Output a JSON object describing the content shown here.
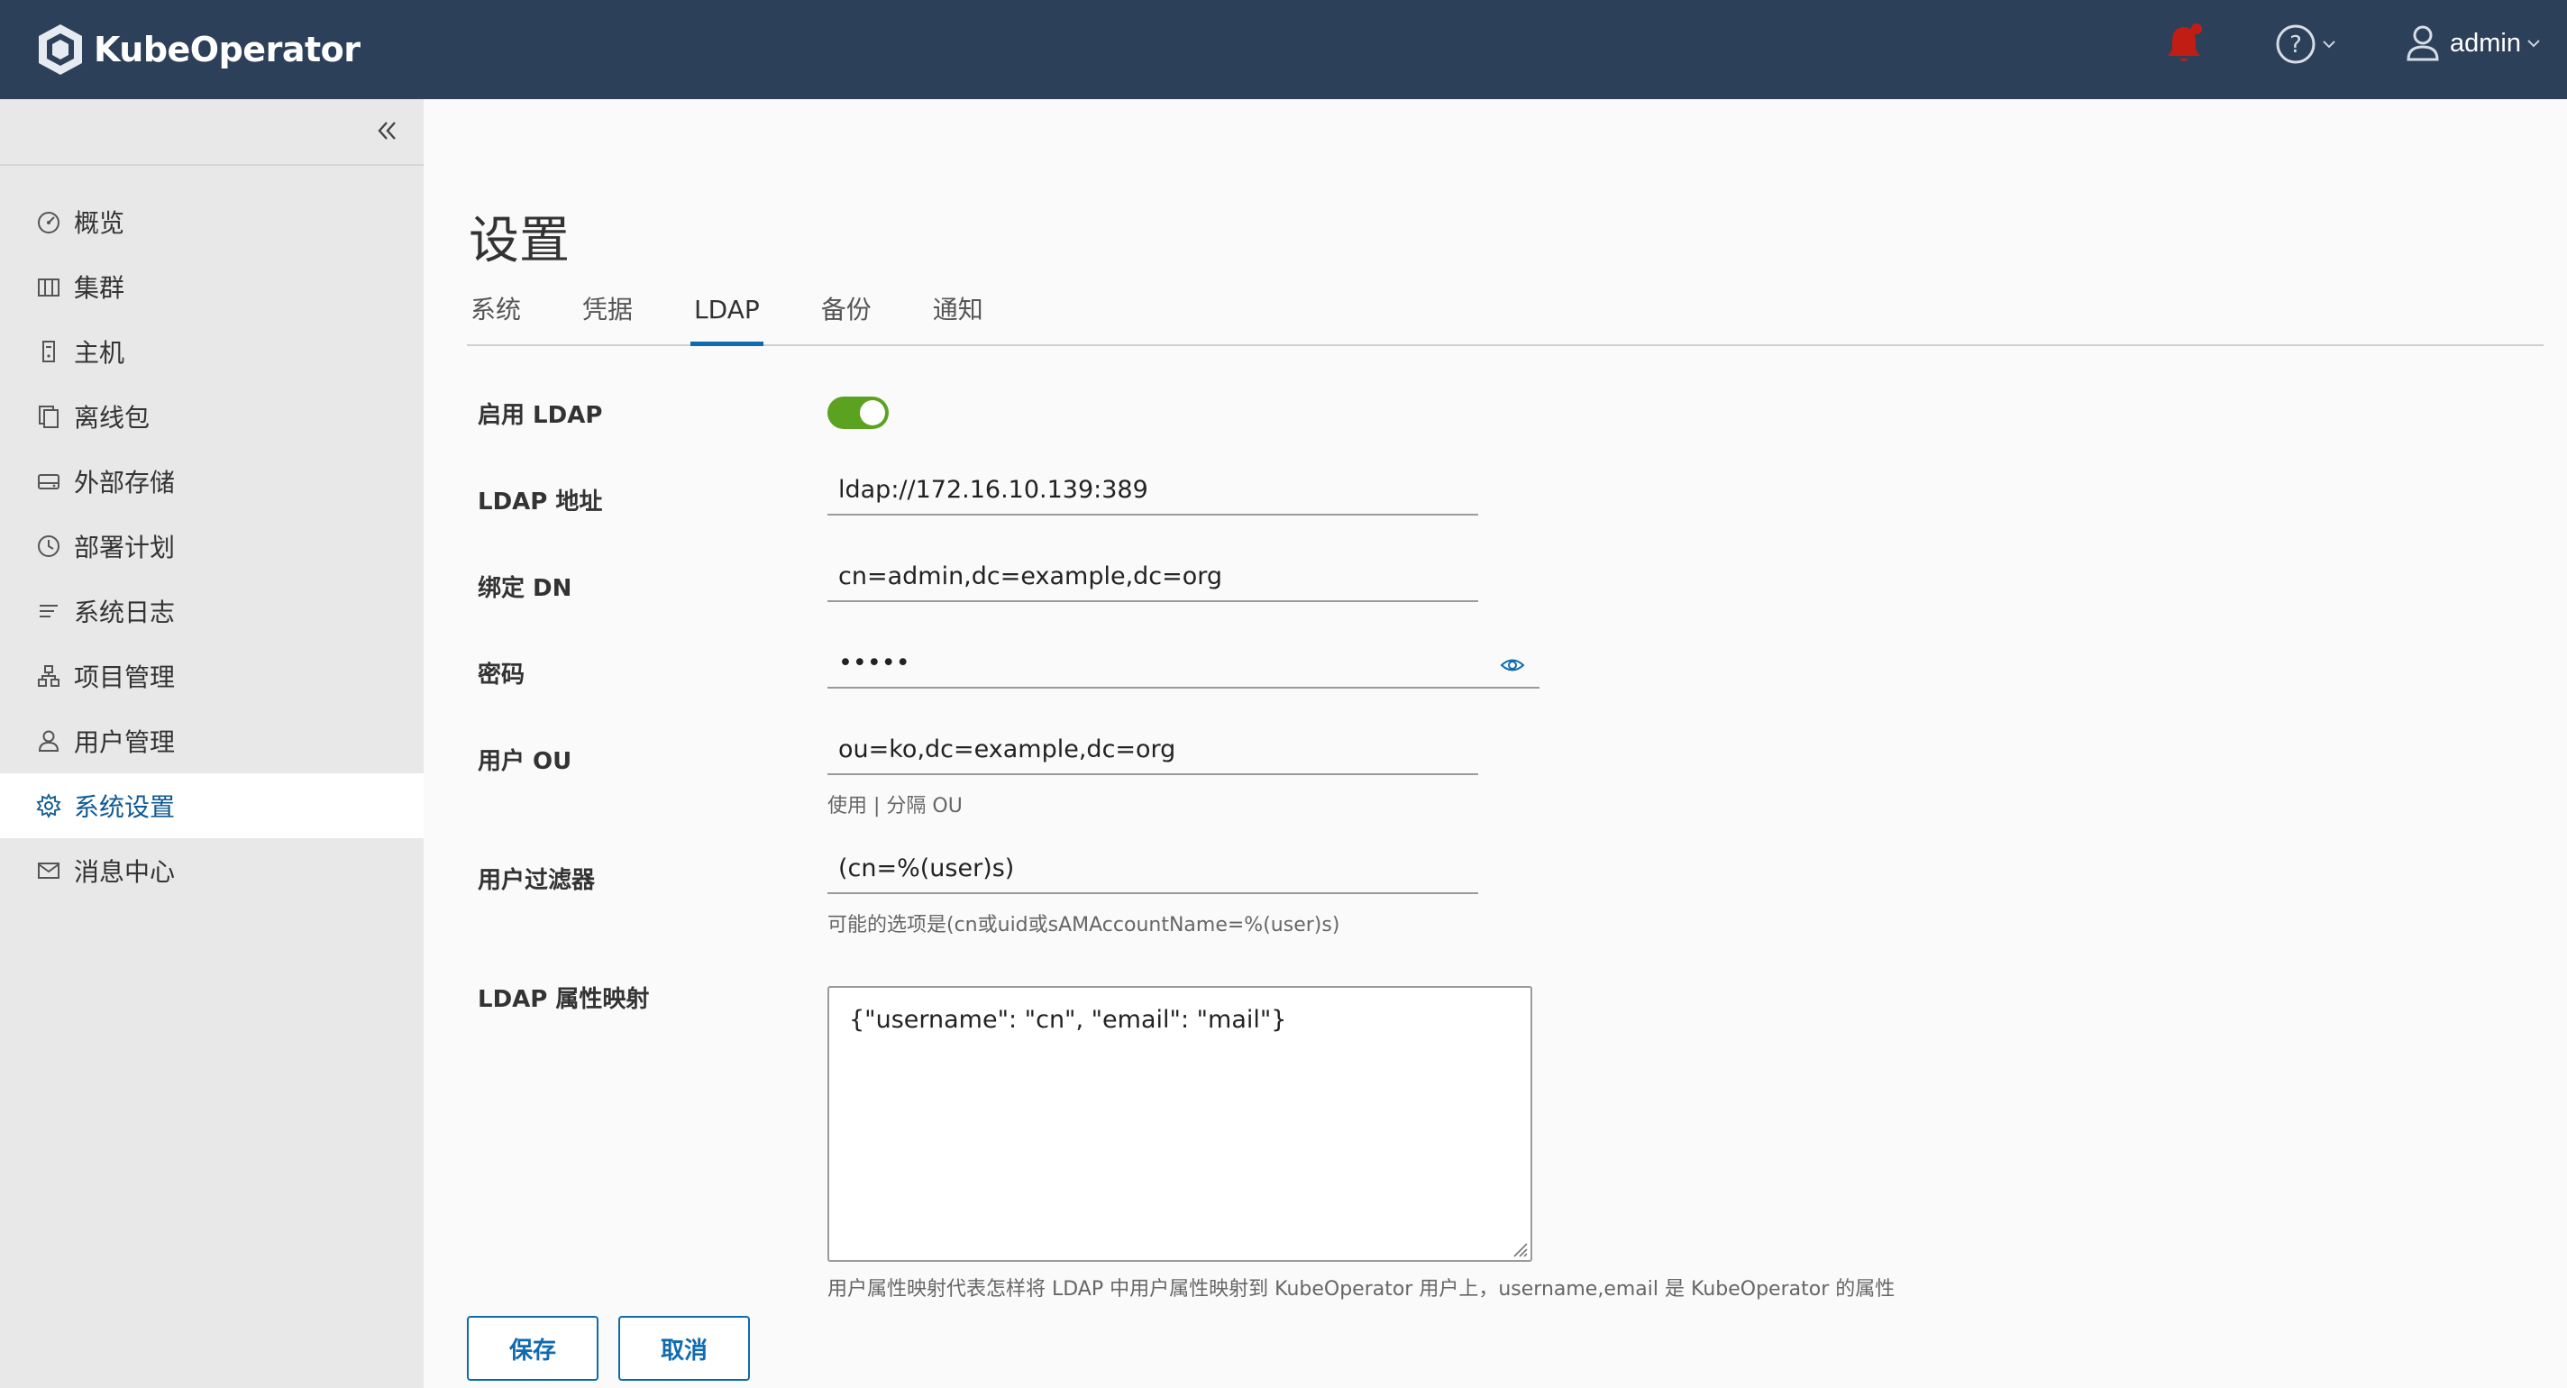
{
  "app": {
    "name": "KubeOperator",
    "user": "admin"
  },
  "sidebar": {
    "items": [
      {
        "label": "概览",
        "icon": "dashboard-icon"
      },
      {
        "label": "集群",
        "icon": "cluster-icon"
      },
      {
        "label": "主机",
        "icon": "host-icon"
      },
      {
        "label": "离线包",
        "icon": "package-icon"
      },
      {
        "label": "外部存储",
        "icon": "storage-icon"
      },
      {
        "label": "部署计划",
        "icon": "plan-icon"
      },
      {
        "label": "系统日志",
        "icon": "log-icon"
      },
      {
        "label": "项目管理",
        "icon": "project-icon"
      },
      {
        "label": "用户管理",
        "icon": "user-icon"
      },
      {
        "label": "系统设置",
        "icon": "settings-icon",
        "active": true
      },
      {
        "label": "消息中心",
        "icon": "mail-icon"
      }
    ]
  },
  "page": {
    "title": "设置",
    "tabs": [
      "系统",
      "凭据",
      "LDAP",
      "备份",
      "通知"
    ],
    "active_tab": "LDAP"
  },
  "form": {
    "enable_label": "启用 LDAP",
    "enabled": true,
    "address_label": "LDAP 地址",
    "address_value": "ldap://172.16.10.139:389",
    "bind_dn_label": "绑定 DN",
    "bind_dn_value": "cn=admin,dc=example,dc=org",
    "password_label": "密码",
    "password_value": "•••••",
    "ou_label": "用户 OU",
    "ou_value": "ou=ko,dc=example,dc=org",
    "ou_helper": "使用 | 分隔 OU",
    "filter_label": "用户过滤器",
    "filter_value": "(cn=%(user)s)",
    "filter_helper": "可能的选项是(cn或uid或sAMAccountName=%(user)s)",
    "mapping_label": "LDAP 属性映射",
    "mapping_value": "{\"username\": \"cn\",  \"email\": \"mail\"}",
    "mapping_helper": "用户属性映射代表怎样将 LDAP 中用户属性映射到 KubeOperator 用户上，username,email 是 KubeOperator 的属性"
  },
  "buttons": {
    "save": "保存",
    "cancel": "取消"
  },
  "colors": {
    "header_bg": "#2c4059",
    "accent": "#0f6bb0",
    "toggle_on": "#5aa220",
    "bell": "#c21d14"
  }
}
